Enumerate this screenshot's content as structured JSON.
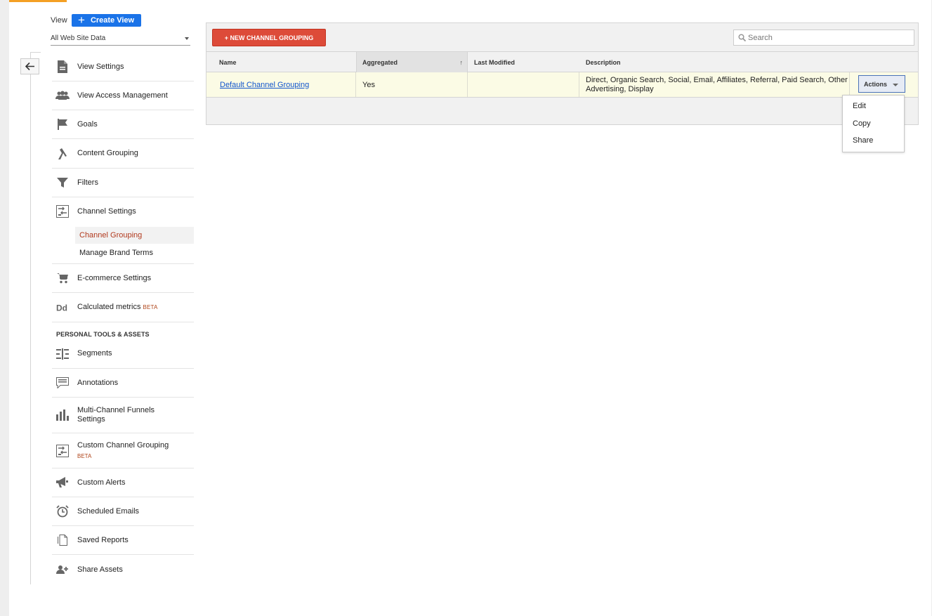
{
  "view": {
    "label": "View",
    "create_button": "Create View",
    "selected": "All Web Site Data"
  },
  "sidebar": {
    "items": [
      {
        "label": "View Settings",
        "icon": "file-icon"
      },
      {
        "label": "View Access Management",
        "icon": "people-icon"
      },
      {
        "label": "Goals",
        "icon": "flag-icon"
      },
      {
        "label": "Content Grouping",
        "icon": "content-grouping-icon"
      },
      {
        "label": "Filters",
        "icon": "filter-icon"
      },
      {
        "label": "Channel Settings",
        "icon": "channel-settings-icon"
      },
      {
        "label": "E-commerce Settings",
        "icon": "cart-icon"
      },
      {
        "label": "Calculated metrics",
        "icon": "calculated-metrics-icon",
        "badge": "BETA"
      },
      {
        "label": "Segments",
        "icon": "segments-icon"
      },
      {
        "label": "Annotations",
        "icon": "annotation-icon"
      },
      {
        "label": "Multi-Channel Funnels Settings",
        "icon": "bar-chart-icon"
      },
      {
        "label": "Custom Channel Grouping",
        "icon": "channel-settings-icon",
        "badge": "BETA"
      },
      {
        "label": "Custom Alerts",
        "icon": "megaphone-icon"
      },
      {
        "label": "Scheduled Emails",
        "icon": "alarm-clock-icon"
      },
      {
        "label": "Saved Reports",
        "icon": "saved-report-icon"
      },
      {
        "label": "Share Assets",
        "icon": "add-person-icon"
      }
    ],
    "sub_items": [
      {
        "label": "Channel Grouping",
        "active": true
      },
      {
        "label": "Manage Brand Terms",
        "active": false
      }
    ],
    "section_heading": "PERSONAL TOOLS & ASSETS"
  },
  "toolbar": {
    "new_button": "+ NEW CHANNEL GROUPING",
    "search_placeholder": "Search"
  },
  "table": {
    "headers": [
      "Name",
      "Aggregated",
      "Last Modified",
      "Description"
    ],
    "sorted_column": "Aggregated",
    "rows": [
      {
        "name": "Default Channel Grouping",
        "aggregated": "Yes",
        "last_modified": "",
        "description": "Direct, Organic Search, Social, Email, Affiliates, Referral, Paid Search, Other Advertising, Display",
        "actions_label": "Actions"
      }
    ]
  },
  "actions_menu": [
    "Edit",
    "Copy",
    "Share"
  ],
  "colors": {
    "primary_blue": "#1a73e8",
    "new_button_red": "#dd4b39",
    "active_red": "#b23a1e",
    "link_blue": "#1155cc"
  }
}
